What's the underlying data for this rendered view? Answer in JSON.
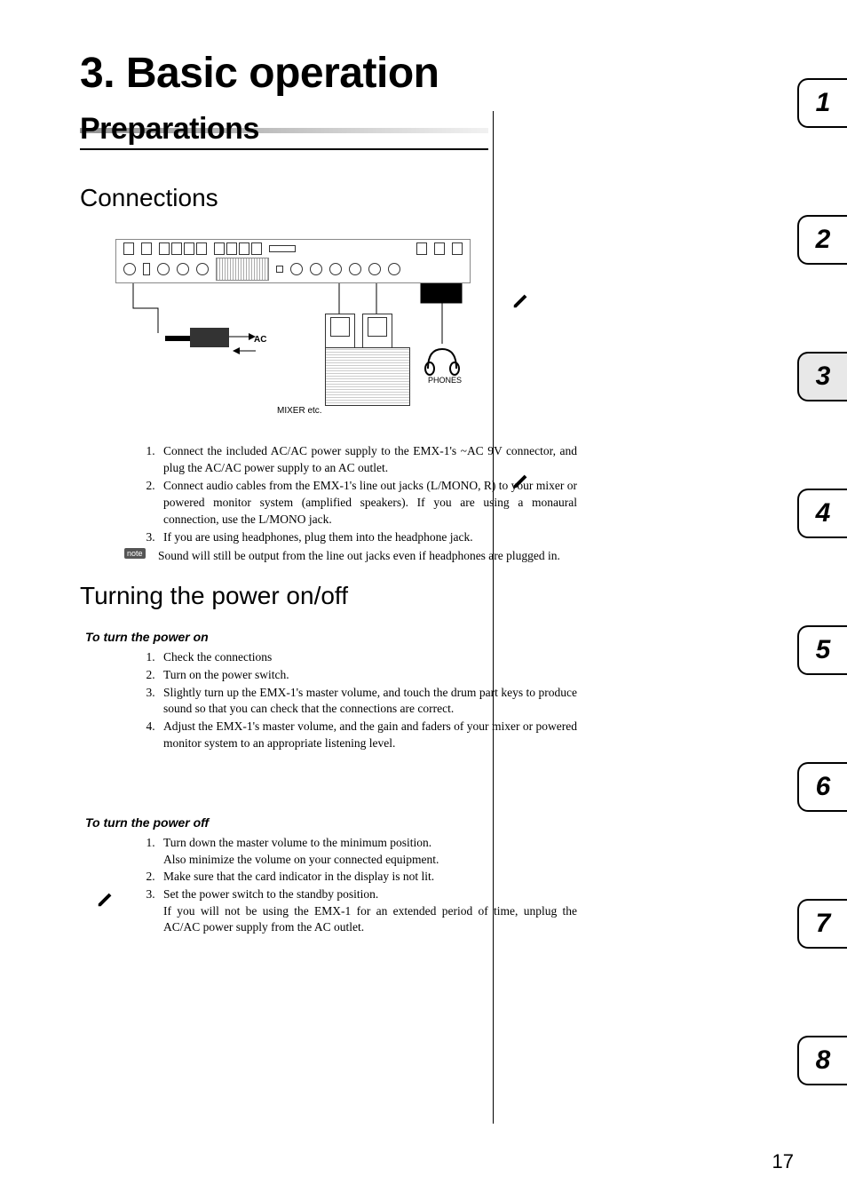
{
  "chapter": "3. Basic operation",
  "section": "Preparations",
  "sub_connections": "Connections",
  "diagram": {
    "ac": "AC",
    "mixer": "MIXER etc.",
    "phones": "PHONES"
  },
  "steps_connections": [
    "Connect the included AC/AC power supply to the EMX-1's ~AC 9V connector, and plug the AC/AC power supply to an AC outlet.",
    "Connect audio cables from the EMX-1's line out jacks (L/MONO, R) to your mixer or powered monitor system (amplified speakers). If you are using a monaural connection, use the L/MONO jack.",
    "If you are using headphones, plug them into the headphone jack."
  ],
  "note_badge": "note",
  "note_text": "Sound will still be output from the line out jacks even if headphones are plugged in.",
  "sub_power": "Turning the power on/off",
  "to_on_h": "To turn the power on",
  "steps_on": [
    "Check the connections",
    "Turn on the power switch.",
    "Slightly turn up the EMX-1's master volume, and touch the drum part keys to produce sound so that you can check that the connections are correct.",
    "Adjust the EMX-1's master volume, and the gain and faders of your mixer or powered monitor system to an appropriate listening level."
  ],
  "to_off_h": "To turn the power off",
  "steps_off": [
    "Turn down the master volume to the minimum position.\nAlso minimize the volume on your connected equipment.",
    "Make sure that the card indicator in the display is not lit.",
    " Set the power switch to the standby position.\nIf you will not be using the EMX-1 for an extended period of time, unplug the AC/AC power supply from the AC outlet."
  ],
  "tabs": [
    "1",
    "2",
    "3",
    "4",
    "5",
    "6",
    "7",
    "8"
  ],
  "active_tab": "3",
  "page_number": "17"
}
